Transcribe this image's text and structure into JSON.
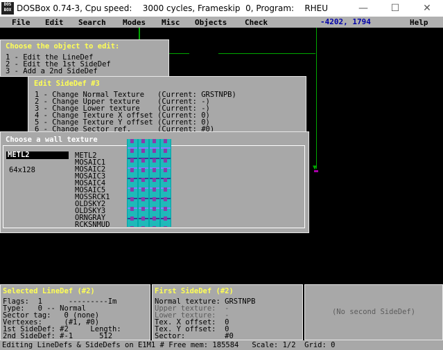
{
  "window": {
    "title": "DOSBox 0.74-3, Cpu speed:    3000 cycles, Frameskip  0, Program:    RHEU",
    "icon_label": "DOS BOX",
    "minimize": "—",
    "maximize": "☐",
    "close": "✕"
  },
  "menubar": {
    "items": [
      "File",
      "Edit",
      "Search",
      "Modes",
      "Misc",
      "Objects",
      "Check"
    ],
    "coords": "-4202, 1794",
    "help": "Help"
  },
  "choose_object": {
    "title": "Choose the object to edit:",
    "options": [
      "1 - Edit the LineDef",
      "2 - Edit the 1st SideDef",
      "3 - Add a 2nd SideDef"
    ]
  },
  "edit_sidedef": {
    "title": "Edit SideDef #3",
    "options": [
      "1 - Change Normal Texture   (Current: GRSTNPB)",
      "2 - Change Upper texture    (Current: -)",
      "3 - Change Lower texture    (Current: -)",
      "4 - Change Texture X offset (Current: 0)",
      "5 - Change Texture Y offset (Current: 0)",
      "6 - Change Sector ref.      (Current: #0)"
    ]
  },
  "texture_chooser": {
    "title": "Choose a wall texture",
    "input_value": "METL2",
    "size": "64x128",
    "list": [
      "METL2",
      "MOSAIC1",
      "MOSAIC2",
      "MOSAIC3",
      "MOSAIC4",
      "MOSAIC5",
      "MOSSRCK1",
      "OLDSKY2",
      "OLDSKY3",
      "ORNGRAY",
      "RCKSNMUD"
    ]
  },
  "selected_linedef": {
    "title": "Selected LineDef (#2)",
    "rows": [
      "Flags:  1      ---------Im",
      "Type:   0 -- Normal",
      "Sector tag:   0 (none)",
      "Vertexes:     (#1, #0)",
      "1st SideDef: #2     Length:",
      "2nd SideDef: #-1      512"
    ]
  },
  "first_sidedef": {
    "title": "First SideDef (#2)",
    "rows": [
      "Normal texture: GRSTNPB",
      "Upper texture:  -",
      "Lower texture:  -",
      "Tex. X offset:  0",
      "Tex. Y offset:  0",
      "Sector:         #0"
    ]
  },
  "second_sidedef": {
    "text": "(No second SideDef)"
  },
  "status": {
    "text": "Editing LineDefs & SideDefs on E1M1 # Free mem: 185584   Scale: 1/2  Grid: 0"
  },
  "colors": {
    "panel": "#a8a8a8",
    "title_yellow": "#ffff55",
    "map_line": "#00a800",
    "coords_blue": "#0000a8",
    "vertex_magenta": "#a800a8"
  }
}
